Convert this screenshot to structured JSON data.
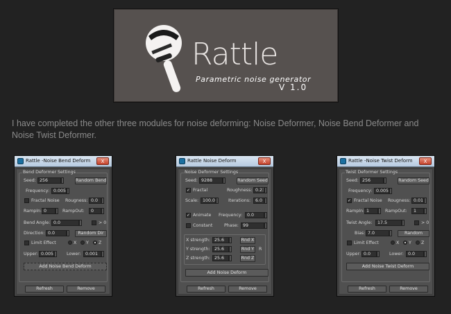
{
  "banner": {
    "title": "Rattle",
    "subtitle": "Parametric noise generator",
    "version": "V 1.0"
  },
  "intro_text": "I have completed the other three modules for noise deforming: Noise Deformer, Noise Bend Deformer and Noise Twist Deformer.",
  "bend": {
    "window_title": "Rattle -Noise Bend Deform",
    "close": "X",
    "group": "Bend Deformer Settings",
    "seed_label": "Seed:",
    "seed": "256",
    "random_bend": "Random Bend",
    "freq_label": "Frequency:",
    "freq": "0.005",
    "fractal_noise": "Fractal Noise",
    "roughness_label": "Rougness:",
    "roughness": "0.0",
    "rampin_label": "RampIn:",
    "rampin": "0",
    "rampout_label": "RampOut:",
    "rampout": "0",
    "bend_angle_label": "Bend Angle:",
    "bend_angle": "0.0",
    "gt0": "> 0",
    "direction_label": "Direction:",
    "direction": "0.0",
    "random_dir": "Random Dir",
    "limit_effect": "Limit Effect",
    "axis_x": "X",
    "axis_y": "Y",
    "axis_z": "Z",
    "upper_label": "Upper:",
    "upper": "0.005",
    "lower_label": "Lower:",
    "lower": "0.001",
    "add_button": "Add Noise Bend Deform",
    "refresh": "Refresh",
    "remove": "Remove"
  },
  "noise": {
    "window_title": "Rattle Noise Deform",
    "close": "X",
    "group": "Noise Deformer Settings",
    "seed_label": "Seed:",
    "seed": "9288",
    "random_seed": "Random Seed",
    "fractal": "Fractal",
    "roughness_label": "Roughness:",
    "roughness": "0.23",
    "scale_label": "Scale:",
    "scale": "100.0",
    "iterations_label": "Iterations:",
    "iterations": "6.0",
    "animate": "Animate",
    "frequency_label": "Frequency:",
    "frequency": "0.0",
    "constant": "Constant",
    "phase_label": "Phase:",
    "phase": "99",
    "xs_label": "X strength:",
    "xs": "25.6",
    "rnd_x": "Rnd X",
    "ys_label": "Y strength:",
    "ys": "25.6",
    "rnd_y": "Rnd Y",
    "r": "R",
    "zs_label": "Z strength:",
    "zs": "25.6",
    "rnd_z": "Rnd Z",
    "add_button": "Add Noise Deform",
    "refresh": "Refresh",
    "remove": "Remove"
  },
  "twist": {
    "window_title": "Rattle -Noise Twist Deform",
    "close": "X",
    "group": "Twist Deformer Settings",
    "seed_label": "Seed:",
    "seed": "256",
    "random_seed": "Random Seed",
    "freq_label": "Frequency:",
    "freq": "0.005",
    "fractal_noise": "Fractal Noise",
    "roughness_label": "Rougness:",
    "roughness": "0.01",
    "rampin_label": "RampIn:",
    "rampin": "1",
    "rampout_label": "RampOut:",
    "rampout": "1",
    "twist_angle_label": "Twist Angle:",
    "twist_angle": "17.5",
    "gt0": "> 0",
    "bias_label": "Bias:",
    "bias": "7.0",
    "random": "Random",
    "limit_effect": "Limit Effect",
    "axis_x": "X",
    "axis_y": "Y",
    "axis_z": "Z",
    "upper_label": "Upper:",
    "upper": "0.0",
    "lower_label": "Lower:",
    "lower": "0.0",
    "add_button": "Add Noise Twist Deform",
    "refresh": "Refresh",
    "remove": "Remove"
  }
}
